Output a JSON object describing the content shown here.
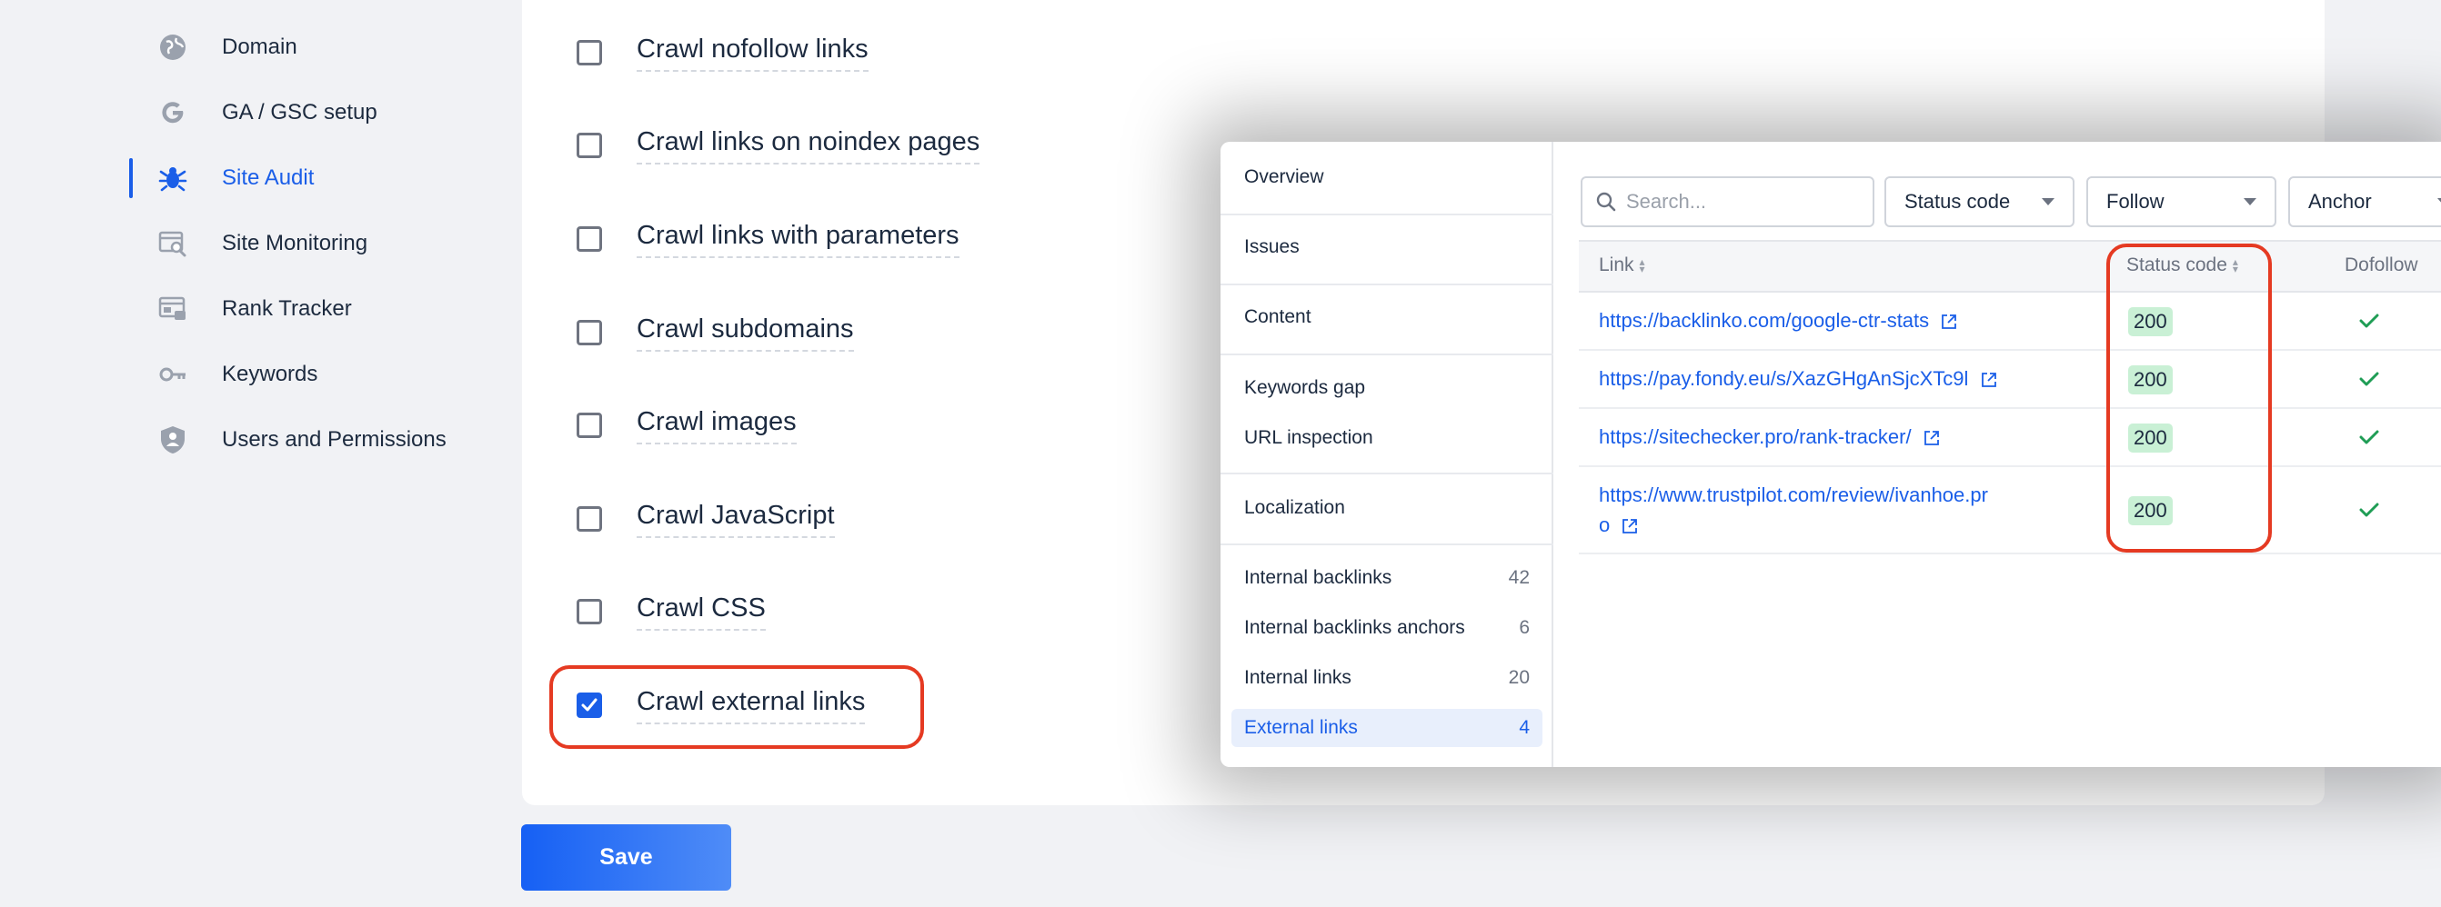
{
  "sidebar": {
    "items": [
      {
        "label": "Domain",
        "icon": "globe-icon"
      },
      {
        "label": "GA / GSC setup",
        "icon": "google-icon"
      },
      {
        "label": "Site Audit",
        "icon": "bug-icon",
        "active": true
      },
      {
        "label": "Site Monitoring",
        "icon": "monitor-search-icon"
      },
      {
        "label": "Rank Tracker",
        "icon": "rank-tracker-icon"
      },
      {
        "label": "Keywords",
        "icon": "key-icon"
      },
      {
        "label": "Users and Permissions",
        "icon": "shield-user-icon"
      }
    ]
  },
  "settings": {
    "options": [
      {
        "label": "Crawl nofollow links",
        "checked": false
      },
      {
        "label": "Crawl links on noindex pages",
        "checked": false
      },
      {
        "label": "Crawl links with parameters",
        "checked": false
      },
      {
        "label": "Crawl subdomains",
        "checked": false
      },
      {
        "label": "Crawl images",
        "checked": false
      },
      {
        "label": "Crawl JavaScript",
        "checked": false
      },
      {
        "label": "Crawl CSS",
        "checked": false
      },
      {
        "label": "Crawl external links",
        "checked": true
      }
    ],
    "save_label": "Save"
  },
  "overlay": {
    "nav": [
      {
        "label": "Overview",
        "count": ""
      },
      {
        "label": "Issues",
        "count": ""
      },
      {
        "label": "Content",
        "count": ""
      },
      {
        "label": "Keywords gap",
        "count": ""
      },
      {
        "label": "URL inspection",
        "count": ""
      },
      {
        "label": "Localization",
        "count": ""
      },
      {
        "label": "Internal backlinks",
        "count": "42"
      },
      {
        "label": "Internal backlinks anchors",
        "count": "6"
      },
      {
        "label": "Internal links",
        "count": "20"
      },
      {
        "label": "External links",
        "count": "4",
        "active": true
      }
    ],
    "search_placeholder": "Search...",
    "filters": [
      "Status code",
      "Follow",
      "Anchor"
    ],
    "table": {
      "headers": [
        "Link",
        "Status code",
        "Dofollow"
      ],
      "rows": [
        {
          "link": "https://backlinko.com/google-ctr-stats",
          "status": "200"
        },
        {
          "link": "https://pay.fondy.eu/s/XazGHgAnSjcXTc9l",
          "status": "200"
        },
        {
          "link": "https://sitechecker.pro/rank-tracker/",
          "status": "200"
        },
        {
          "link_line1": "https://www.trustpilot.com/review/ivanhoe.pr",
          "link_line2": "o",
          "status": "200"
        }
      ]
    }
  },
  "colors": {
    "accent": "#1a5ee8",
    "highlight": "#e53a22",
    "success": "#1f9d55",
    "badge_bg": "#c9f0d5"
  }
}
